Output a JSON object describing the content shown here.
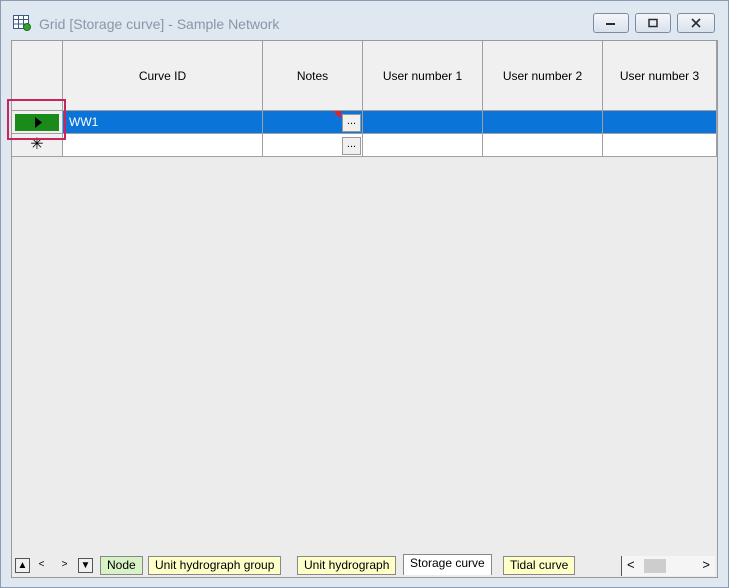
{
  "window": {
    "title": "Grid [Storage curve] - Sample Network",
    "minimize_label": "minimize",
    "maximize_label": "maximize",
    "close_label": "close"
  },
  "grid": {
    "columns": [
      "Curve ID",
      "Notes",
      "User number 1",
      "User number 2",
      "User number 3"
    ],
    "rows": [
      {
        "curve_id": "WW1",
        "notes": "",
        "user1": "",
        "user2": "",
        "user3": "",
        "selected": true
      },
      {
        "curve_id": "",
        "notes": "",
        "user1": "",
        "user2": "",
        "user3": "",
        "new_row_marker": "✳"
      }
    ],
    "ellipsis": "..."
  },
  "tabs": [
    {
      "label": "Node",
      "color": "#d7f2c5"
    },
    {
      "label": "Unit hydrograph group",
      "color": "#ffffc8"
    },
    {
      "label": "Unit hydrograph",
      "color": "#ffffc8"
    },
    {
      "label": "Storage curve",
      "color": "#ffffff",
      "active": true
    },
    {
      "label": "Tidal curve",
      "color": "#ffffc8"
    }
  ],
  "nav": {
    "first": "▲",
    "prev": "<",
    "next": ">",
    "last": "▼"
  },
  "scroll": {
    "left": "<",
    "right": ">"
  },
  "colors": {
    "selection": "#0a74d8",
    "row_indicator": "#1a8a1a",
    "highlight_box": "#c8245e"
  }
}
